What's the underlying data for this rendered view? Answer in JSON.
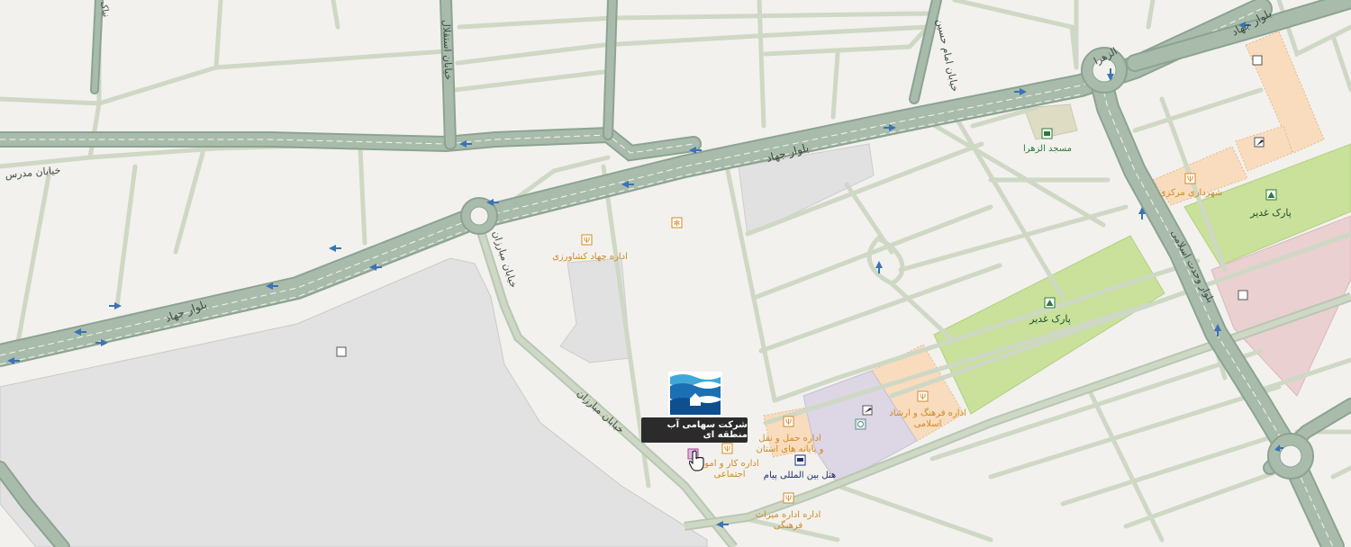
{
  "roads": {
    "jahad_boulevard_top": "بلوار جهاد",
    "jahad_boulevard_mid": "بلوار جهاد",
    "jahad_boulevard_bottom": "بلوار جهاد",
    "modarres_street": "خیابان مدرس",
    "esteghlal_street": "خیابان استقلال",
    "imam_hossein_street": "خیابان امام حسین",
    "mobarezan_street_upper": "خیابان مبارزان",
    "mobarezan_street_lower": "خیابان مبارزان",
    "vahdat_eslami_boulevard": "بلوار وحدت اسلامی",
    "alzahra_square": "الزهرا",
    "partial_top_left": "نیاک"
  },
  "pois": {
    "jahad_keshavarzi": "اداره جهاد کشاورزی",
    "alzahra_mosque": "مسجد الزهرا",
    "central_municipality": "شهرداری مرکزی",
    "ghadir_park_east": "پارک غدیر",
    "ghadir_park_main": "پارک غدیر",
    "culture_guidance_line1": "اداره فرهنگ و ارشاد",
    "culture_guidance_line2": "اسلامی",
    "transport_line1": "اداره حمل و نقل",
    "transport_line2": "و پایانه های استان",
    "labor_office_line1": "اداره کار و امور",
    "labor_office_line2": "اجتماعی",
    "payam_hotel": "هتل بین المللی پیام",
    "heritage_line1": "اداره اداره میراث",
    "heritage_line2": "فرهنگی"
  },
  "tooltip": {
    "text": "شرکت سهامی آب منطقه ای"
  },
  "colors": {
    "background": "#f2f1ee",
    "road_major_fill": "#9fb3a3",
    "road_major_casing": "#8ca392",
    "road_minor": "#cfd8c4",
    "park": "#c9e19a",
    "institutional": "#f8dcbd",
    "institutional_border": "#e8b98a",
    "purple_block": "#ddd6e5",
    "pink_block": "#ead0d1",
    "grey_block": "#e2e2e3",
    "poi_orange": "#d08a24",
    "oneway_arrow": "#3b73b4",
    "tooltip_bg": "#2b2b2b"
  },
  "icons": [
    "poi-marker-icon",
    "park-tree-icon",
    "mosque-icon",
    "hotel-bed-icon",
    "oneway-arrow-icon",
    "cursor-hand-icon",
    "water-company-logo"
  ]
}
